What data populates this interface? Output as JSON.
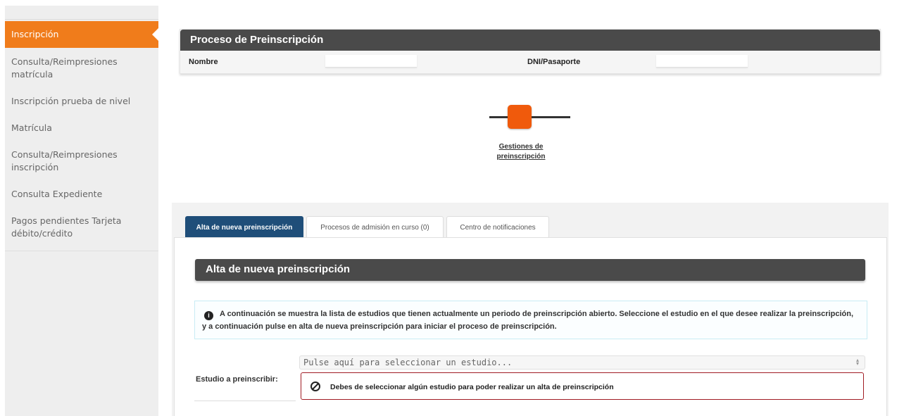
{
  "sidebar": {
    "items": [
      {
        "label": "Inscripción",
        "active": true
      },
      {
        "label": "Consulta/Reimpresiones matrícula"
      },
      {
        "label": "Inscripción prueba de nivel"
      },
      {
        "label": "Matrícula"
      },
      {
        "label": "Consulta/Reimpresiones inscripción"
      },
      {
        "label": "Consulta Expediente"
      },
      {
        "label": "Pagos pendientes Tarjeta débito/crédito"
      }
    ]
  },
  "process": {
    "title": "Proceso de Preinscripción",
    "name_label": "Nombre",
    "name_value": "",
    "dni_label": "DNI/Pasaporte",
    "dni_value": ""
  },
  "stepper": {
    "label": "Gestiones de preinscripción",
    "color": "#f05a0c"
  },
  "tabs": [
    {
      "label": "Alta de nueva preinscripción",
      "active": true
    },
    {
      "label": "Procesos de admisión en curso (0)"
    },
    {
      "label": "Centro de notificaciones"
    }
  ],
  "alta": {
    "title": "Alta de nueva preinscripción",
    "info_icon": "info-circle-icon",
    "info_text": "A continuación se muestra la lista de estudios que tienen actualmente un periodo de preinscripción abierto. Seleccione el estudio en el que desee realizar la preinscripción, y a continuación pulse en alta de nueva preinscripción para iniciar el proceso de preinscripción.",
    "estudio_label": "Estudio a preinscribir:",
    "select_placeholder": "Pulse aquí para seleccionar un estudio...",
    "error_icon": "ban-icon",
    "error_text": "Debes de seleccionar algún estudio para poder realizar un alta de preinscripción"
  },
  "colors": {
    "accent": "#f07c1b",
    "tab_active": "#1f4e79",
    "header_dark": "#4a4a4a",
    "error_border": "#a11c24"
  }
}
